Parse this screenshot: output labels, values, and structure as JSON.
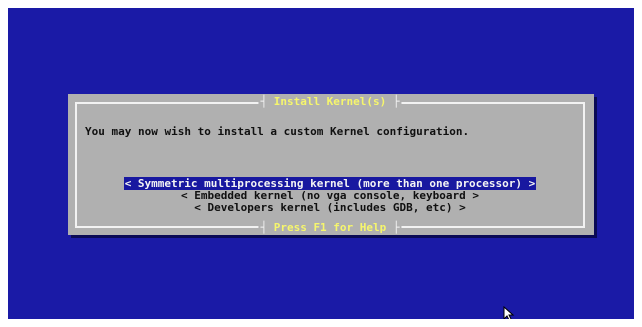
{
  "dialog": {
    "title": "Install Kernel(s)",
    "message": "You may now wish to install a custom Kernel configuration.",
    "menu": [
      "< Symmetric multiprocessing kernel (more than one processor) >",
      "< Embedded kernel (no vga console, keyboard >",
      "< Developers kernel (includes GDB, etc) >"
    ],
    "selected_index": 0,
    "help": "Press F1 for Help"
  },
  "colors": {
    "background": "#1a1aa6",
    "dialog": "#b0b0b0",
    "caption": "#f6f66c",
    "highlight": "#1818a0"
  },
  "cursor": {
    "icon": "mouse-pointer-icon"
  }
}
